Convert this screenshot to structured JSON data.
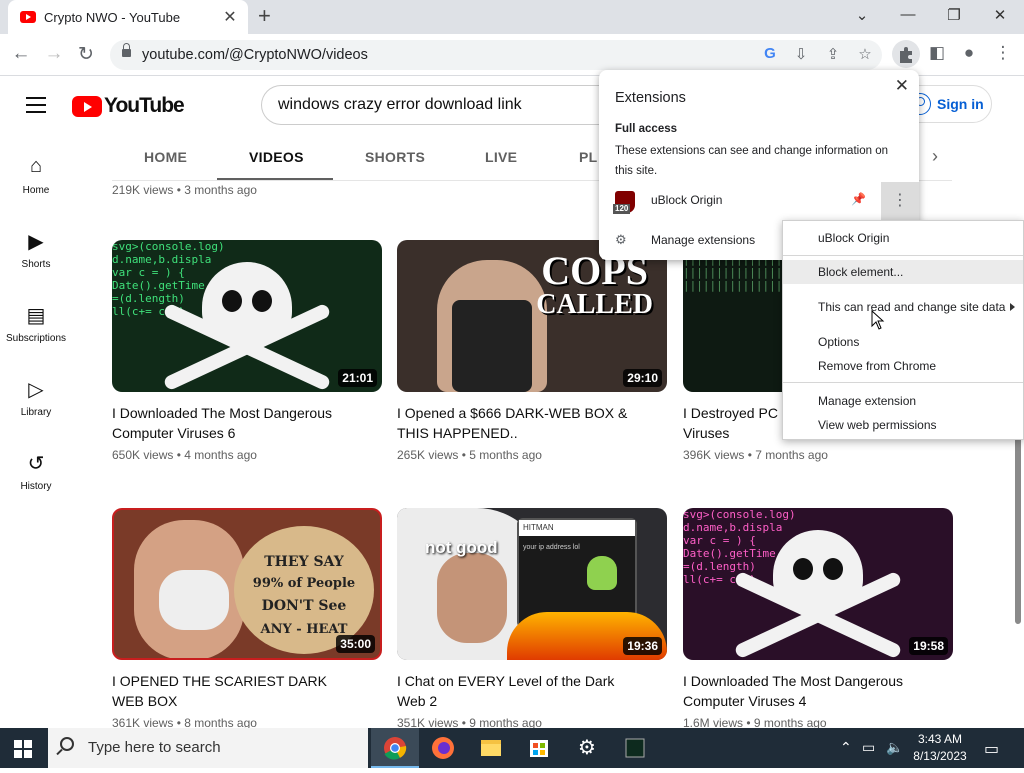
{
  "browser": {
    "tab_title": "Crypto NWO - YouTube",
    "tab_close": "✕",
    "new_tab": "+",
    "url": "youtube.com/@CryptoNWO/videos",
    "window_controls": [
      "⌄",
      "—",
      "❐",
      "✕"
    ]
  },
  "youtube": {
    "logo_text": "YouTube",
    "search_value": "windows crazy error download link",
    "signin_label": "Sign in",
    "guide": [
      {
        "label": "Home",
        "icon": "home-icon"
      },
      {
        "label": "Shorts",
        "icon": "shorts-icon"
      },
      {
        "label": "Subscriptions",
        "icon": "subscriptions-icon"
      },
      {
        "label": "Library",
        "icon": "library-icon"
      },
      {
        "label": "History",
        "icon": "history-icon"
      }
    ],
    "tabs": [
      "HOME",
      "VIDEOS",
      "SHORTS",
      "LIVE",
      "PL"
    ],
    "active_tab": "VIDEOS"
  },
  "videos": {
    "previous_meta": "219K views • 3 months ago",
    "row1": [
      {
        "title": "I Downloaded The Most Dangerous Computer Viruses 6",
        "meta": "650K views • 4 months ago",
        "duration": "21:01"
      },
      {
        "title": "I Opened a $666 DARK-WEB BOX & THIS HAPPENED..",
        "meta": "265K views • 5 months ago",
        "duration": "29:10",
        "thumb_text": [
          "COPS",
          "CALLED"
        ]
      },
      {
        "title": "I Destroyed PC C",
        "title_line2": "Viruses",
        "meta": "396K views • 7 months ago"
      }
    ],
    "row2": [
      {
        "title": "I OPENED THE SCARIEST DARK WEB BOX",
        "meta": "361K views • 8 months ago",
        "duration": "35:00",
        "thumb_text": [
          "THEY SAY",
          "99% of People",
          "DON'T See",
          "ANY - HEAT"
        ]
      },
      {
        "title": "I Chat on EVERY Level of the Dark Web 2",
        "meta": "351K views • 9 months ago",
        "duration": "19:36",
        "thumb_text": [
          "not good",
          "HITMAN",
          "your ip address lol"
        ]
      },
      {
        "title": "I Downloaded The Most Dangerous Computer Viruses 4",
        "meta": "1.6M views • 9 months ago",
        "duration": "19:58"
      }
    ]
  },
  "extensions_popup": {
    "title": "Extensions",
    "close": "✕",
    "section_title": "Full access",
    "section_desc": "These extensions can see and change information on this site.",
    "extension_name": "uBlock Origin",
    "badge": "120",
    "more": "⋮",
    "manage_label": "Manage extensions"
  },
  "context_menu": {
    "items": [
      {
        "label": "uBlock Origin"
      },
      {
        "label": "Block element..."
      },
      {
        "label": "This can read and change site data"
      },
      {
        "label": "Options"
      },
      {
        "label": "Remove from Chrome"
      },
      {
        "label": "Manage extension"
      },
      {
        "label": "View web permissions"
      }
    ]
  },
  "taskbar": {
    "search_placeholder": "Type here to search",
    "time": "3:43 AM",
    "date": "8/13/2023"
  }
}
